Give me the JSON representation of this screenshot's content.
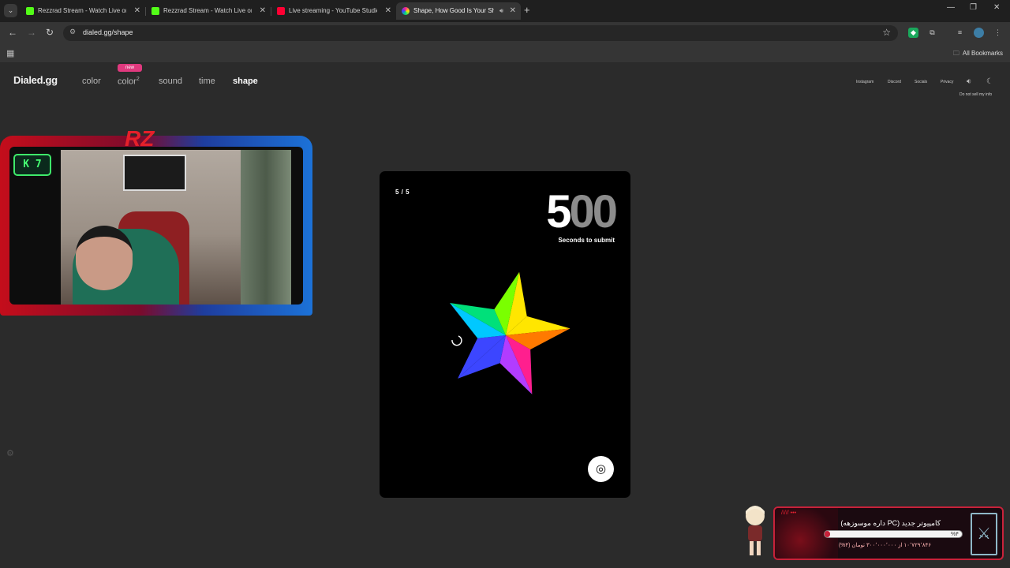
{
  "browser": {
    "tabs": [
      {
        "title": "Rezzrad Stream - Watch Live on Kick",
        "favicon_color": "#53fc18",
        "active": false
      },
      {
        "title": "Rezzrad Stream - Watch Live on Kick",
        "favicon_color": "#53fc18",
        "active": false
      },
      {
        "title": "Live streaming - YouTube Studio",
        "favicon_color": "#ff0033",
        "active": false
      },
      {
        "title": "Shape, How Good Is Your Shape Memory?",
        "favicon_color": "#c47cff",
        "active": true
      }
    ],
    "url": "dialed.gg/shape",
    "all_bookmarks_label": "All Bookmarks"
  },
  "site": {
    "logo": "Dialed.gg",
    "nav": {
      "color": "color",
      "color2": "color",
      "color2_sup": "2",
      "sound": "sound",
      "time": "time",
      "shape": "shape",
      "new_badge": "new"
    },
    "top_links": {
      "instagram": "Instagram",
      "discord": "Discord",
      "socials": "Socials",
      "privacy": "Privacy",
      "do_not_sell": "Do not sell my info"
    }
  },
  "game": {
    "round": "5 / 5",
    "timer_lit": "5",
    "timer_dim": "00",
    "timer_label": "Seconds to submit",
    "star_colors": [
      "#ffe600",
      "#ff7a00",
      "#ff1f8e",
      "#b23cff",
      "#3c46ff",
      "#00c8ff",
      "#00e07a",
      "#7aff00"
    ]
  },
  "overlay": {
    "cam_badge": "K 7",
    "cam_logo": "RZ",
    "donation": {
      "title": "کامپیوتر جدید (PC داره موسوزهه)",
      "progress_label": "%۴",
      "progress_fraction": 0.04,
      "subtitle": "۱۰٬۷۲۹٬۸۴۶ از ۳۰۰٬۰۰۰٬۰۰۰ تومان (۴%)"
    }
  }
}
